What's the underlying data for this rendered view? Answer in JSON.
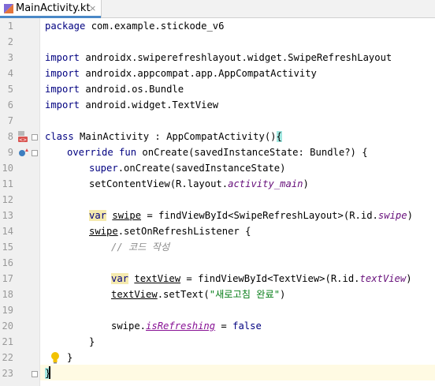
{
  "tab": {
    "title": "MainActivity.kt",
    "close": "×"
  },
  "lines": [
    {
      "n": "1"
    },
    {
      "n": "2"
    },
    {
      "n": "3"
    },
    {
      "n": "4"
    },
    {
      "n": "5"
    },
    {
      "n": "6"
    },
    {
      "n": "7"
    },
    {
      "n": "8"
    },
    {
      "n": "9"
    },
    {
      "n": "10"
    },
    {
      "n": "11"
    },
    {
      "n": "12"
    },
    {
      "n": "13"
    },
    {
      "n": "14"
    },
    {
      "n": "15"
    },
    {
      "n": "16"
    },
    {
      "n": "17"
    },
    {
      "n": "18"
    },
    {
      "n": "19"
    },
    {
      "n": "20"
    },
    {
      "n": "21"
    },
    {
      "n": "22"
    },
    {
      "n": "23"
    }
  ],
  "code": {
    "l1_kw": "package",
    "l1_rest": " com.example.stickode_v6",
    "l3_kw": "import",
    "l3_rest": " androidx.swiperefreshlayout.widget.SwipeRefreshLayout",
    "l4_kw": "import",
    "l4_rest": " androidx.appcompat.app.AppCompatActivity",
    "l5_kw": "import",
    "l5_rest": " android.os.Bundle",
    "l6_kw": "import",
    "l6_rest": " android.widget.TextView",
    "l8_kw": "class",
    "l8_rest": " MainActivity : AppCompatActivity()",
    "l8_brace": "{",
    "l9_kw": "override fun",
    "l9_rest": " onCreate(savedInstanceState: Bundle?) {",
    "l10_kw": "super",
    "l10_rest": ".onCreate(savedInstanceState)",
    "l11_a": "setContentView(R.layout.",
    "l11_it": "activity_main",
    "l11_b": ")",
    "l13_kw": "var",
    "l13_sp": " ",
    "l13_var": "swipe",
    "l13_b": " = findViewById<SwipeRefreshLayout>(R.id.",
    "l13_it": "swipe",
    "l13_c": ")",
    "l14_var": "swipe",
    "l14_rest": ".setOnRefreshListener {",
    "l15_cmt": "// 코드 작성",
    "l17_kw": "var",
    "l17_sp": " ",
    "l17_var": "textView",
    "l17_b": " = findViewById<TextView>(R.id.",
    "l17_it": "textView",
    "l17_c": ")",
    "l18_var": "textView",
    "l18_b": ".setText(",
    "l18_str": "\"새로고침 완료\"",
    "l18_c": ")",
    "l20_a": "swipe.",
    "l20_pp": "isRefreshing",
    "l20_b": " = ",
    "l20_kw": "false",
    "l21": "}",
    "l22": "}",
    "l23": "}"
  },
  "colors": {
    "keyword": "#000080",
    "string": "#067d17",
    "comment": "#8c8c8c",
    "field": "#660e7a",
    "property": "#871094",
    "tab_accent": "#4a88c7"
  },
  "icons": {
    "file": "kotlin-file-icon",
    "layout_marker": "android-layout-icon",
    "override_marker": "override-icon",
    "intention": "lightbulb-icon"
  }
}
